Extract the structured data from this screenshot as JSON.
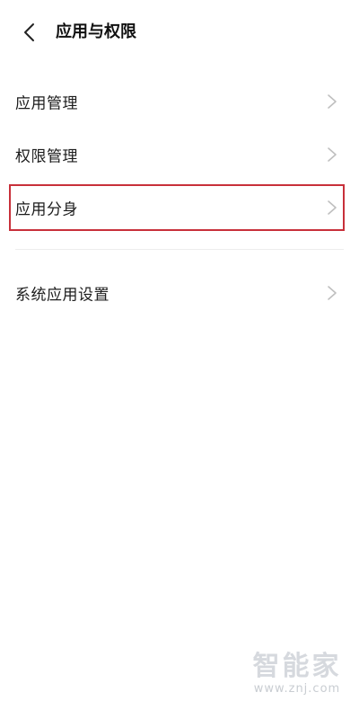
{
  "header": {
    "title": "应用与权限",
    "back_icon": "chevron-left-icon"
  },
  "list": {
    "items": [
      {
        "label": "应用管理",
        "icon": "chevron-right-icon"
      },
      {
        "label": "权限管理",
        "icon": "chevron-right-icon"
      },
      {
        "label": "应用分身",
        "icon": "chevron-right-icon",
        "highlighted": true
      },
      {
        "label": "系统应用设置",
        "icon": "chevron-right-icon"
      }
    ]
  },
  "colors": {
    "highlight": "#c8303a",
    "chevron": "#bfbfbf"
  },
  "watermark": {
    "logo": "智能家",
    "url": "www.znj.com"
  }
}
